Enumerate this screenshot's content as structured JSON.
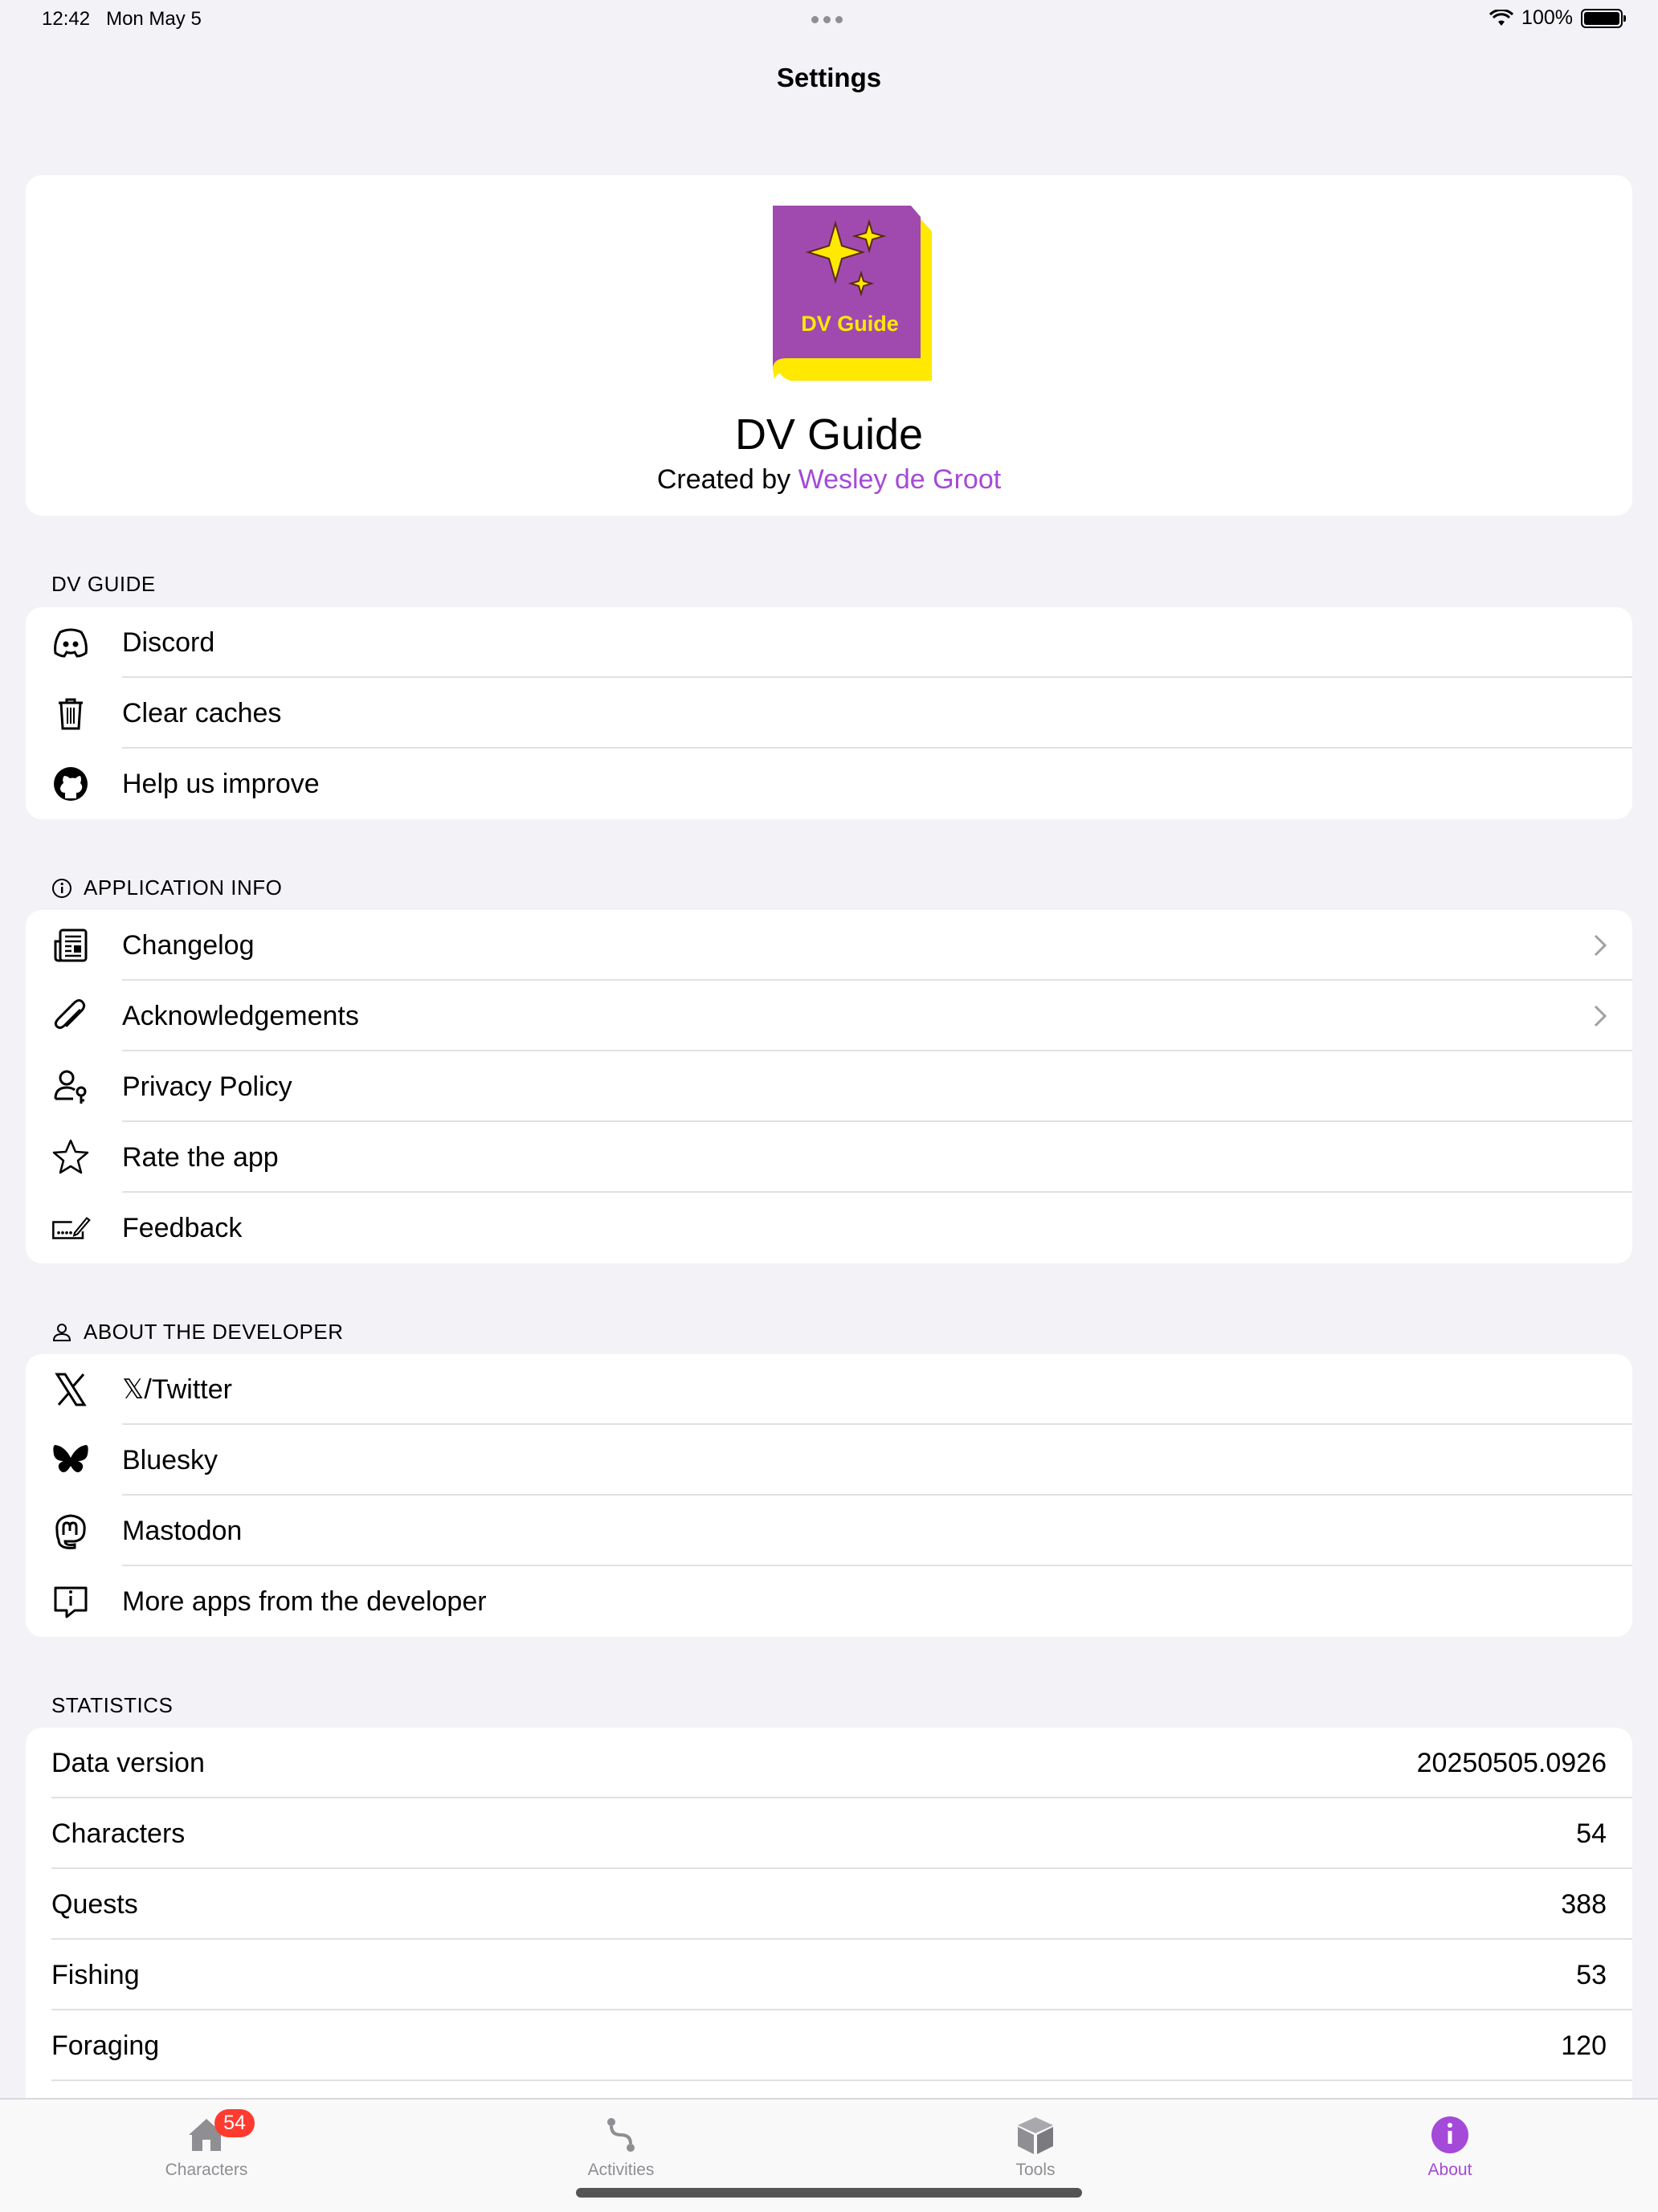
{
  "status_bar": {
    "time": "12:42",
    "date": "Mon May 5",
    "battery_percent": "100%"
  },
  "nav": {
    "title": "Settings"
  },
  "header": {
    "icon_text": "DV Guide",
    "app_name": "DV Guide",
    "created_by": "Created by",
    "developer": "Wesley de Groot"
  },
  "sections": {
    "dv_guide": {
      "title": "DV GUIDE",
      "items": [
        {
          "label": "Discord",
          "icon": "discord-icon"
        },
        {
          "label": "Clear caches",
          "icon": "trash-icon"
        },
        {
          "label": "Help us improve",
          "icon": "github-icon"
        }
      ]
    },
    "app_info": {
      "title": "APPLICATION INFO",
      "items": [
        {
          "label": "Changelog",
          "icon": "newspaper-icon"
        },
        {
          "label": "Acknowledgements",
          "icon": "paperclip-icon"
        },
        {
          "label": "Privacy Policy",
          "icon": "person-key-icon"
        },
        {
          "label": "Rate the app",
          "icon": "star-icon"
        },
        {
          "label": "Feedback",
          "icon": "signature-icon"
        }
      ]
    },
    "developer": {
      "title": "ABOUT THE DEVELOPER",
      "items": [
        {
          "label": "𝕏/Twitter",
          "icon": "x-icon"
        },
        {
          "label": "Bluesky",
          "icon": "butterfly-icon"
        },
        {
          "label": "Mastodon",
          "icon": "mastodon-icon"
        },
        {
          "label": "More apps from the developer",
          "icon": "info-bubble-icon"
        }
      ]
    },
    "statistics": {
      "title": "STATISTICS",
      "rows": [
        {
          "label": "Data version",
          "value": "20250505.0926"
        },
        {
          "label": "Characters",
          "value": "54"
        },
        {
          "label": "Quests",
          "value": "388"
        },
        {
          "label": "Fishing",
          "value": "53"
        },
        {
          "label": "Foraging",
          "value": "120"
        }
      ]
    }
  },
  "tabbar": {
    "tabs": [
      {
        "label": "Characters",
        "badge": "54",
        "icon": "house-icon"
      },
      {
        "label": "Activities",
        "icon": "path-icon"
      },
      {
        "label": "Tools",
        "icon": "box-icon"
      },
      {
        "label": "About",
        "icon": "info-circle-icon",
        "active": true
      }
    ]
  },
  "colors": {
    "accent": "#a549d8",
    "background": "#f2f2f7",
    "badge": "#ff3b30"
  }
}
